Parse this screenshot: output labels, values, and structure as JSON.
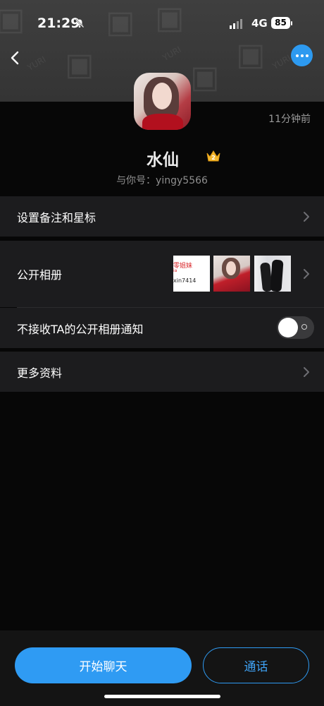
{
  "status_bar": {
    "time": "21:29",
    "network": "4G",
    "battery": "85"
  },
  "header": {
    "watermark_text": "YURI"
  },
  "profile": {
    "time_ago": "11分钟前",
    "name": "水仙",
    "account_line": "与你号：yingy5566",
    "crown_level": "2"
  },
  "rows": {
    "remark": "设置备注和星标",
    "album": "公开相册",
    "album_notify": "不接收TA的公开相册通知",
    "more_info": "更多资料"
  },
  "album_thumb1": {
    "line1": "零姐妹",
    "line2": "ia",
    "line3": "xin7414"
  },
  "toggle": {
    "album_notify_off": true
  },
  "buttons": {
    "chat": "开始聊天",
    "call": "通话"
  },
  "colors": {
    "accent": "#2f9bf3",
    "background": "#070707",
    "row": "#1c1c1e"
  }
}
